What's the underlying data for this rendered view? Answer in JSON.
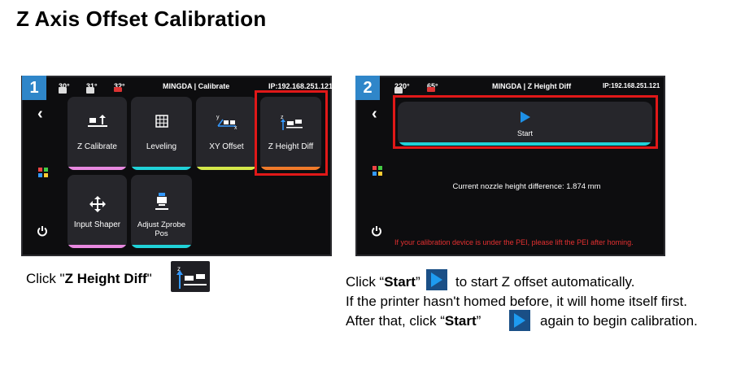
{
  "title": "Z Axis Offset Calibration",
  "colors": {
    "badge": "#2f86c9",
    "highlight": "#e01818",
    "screen_bg": "#0d0d0f",
    "tile_bg": "#26262b",
    "warning": "#e53030",
    "play": "#1e90e6"
  },
  "step1": {
    "badge": "1",
    "status": {
      "nozzle_temp": "30°",
      "bed_temp": "31°",
      "chamber_temp": "32°",
      "title": "MINGDA | Calibrate",
      "ip": "IP:192.168.251.121"
    },
    "sidebar": {
      "back_icon": "chevron-left-icon",
      "apps_icon": "apps-grid-icon",
      "power_icon": "power-icon"
    },
    "tiles": [
      {
        "label": "Z Calibrate",
        "icon": "z-calibrate-icon",
        "accent": "#e889e0"
      },
      {
        "label": "Leveling",
        "icon": "grid-icon",
        "accent": "#20d2d8"
      },
      {
        "label": "XY Offset",
        "icon": "xy-offset-icon",
        "accent": "#d4e84a"
      },
      {
        "label": "Z Height Diff",
        "icon": "z-height-diff-icon",
        "accent": "#f07a2a"
      },
      {
        "label": "Input Shaper",
        "icon": "move-arrows-icon",
        "accent": "#e889e0"
      },
      {
        "label": "Adjust Zprobe Pos",
        "icon": "probe-icon",
        "accent": "#20d2d8"
      }
    ],
    "instruction": {
      "prefix": "Click  \"",
      "bold": "Z Height Diff",
      "suffix": "\""
    }
  },
  "step2": {
    "badge": "2",
    "status": {
      "nozzle_temp": "220°",
      "bed_temp": "65°",
      "title": "MINGDA  | Z Height Diff",
      "ip": "IP:192.168.251.121"
    },
    "start_label": "Start",
    "height_text": "Current nozzle height difference: 1.874 mm",
    "warning_text": "If your calibration device is under the PEI, please lift the PEI after homing.",
    "instructions": {
      "line1": {
        "pre": "Click “",
        "bold": "Start",
        "post": "”",
        "after": "to start Z offset automatically."
      },
      "line2": "If the printer hasn't homed before, it will home itself first.",
      "line3": {
        "pre": "After that, click  “",
        "bold": "Start",
        "post": "”",
        "after": "again to begin calibration."
      }
    }
  }
}
